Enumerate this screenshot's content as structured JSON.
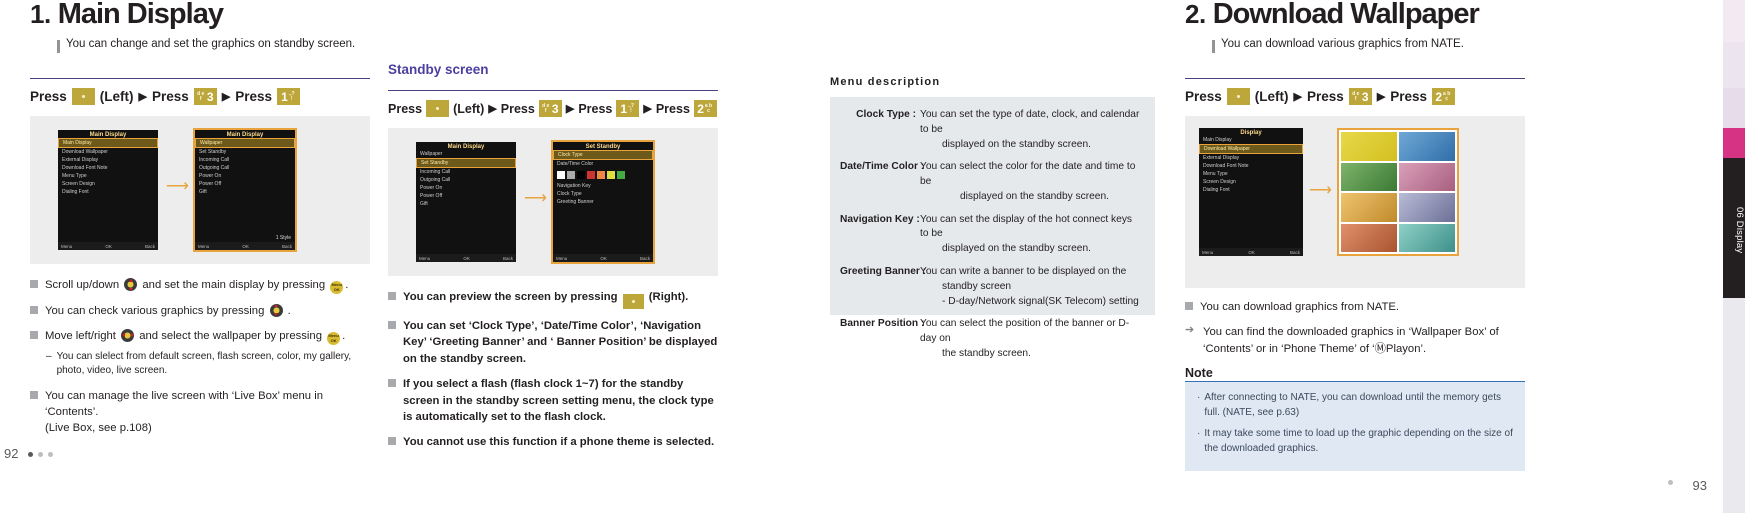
{
  "edge": {
    "tab_label": "06 Display"
  },
  "pages": {
    "left": "92",
    "right": "93"
  },
  "section1": {
    "number": "1.",
    "title": "Main Display",
    "subtitle": "You can change and set the graphics on standby screen.",
    "press_sequence": {
      "press_label": "Press",
      "left_label": "(Left)",
      "arrow": "▶",
      "keys": [
        {
          "type": "dot",
          "label": ""
        },
        {
          "type": "num",
          "big": "3",
          "small": "def"
        },
        {
          "type": "num",
          "big": "1",
          "small": ".,?"
        }
      ]
    },
    "figure": {
      "left_phone": {
        "title": "Main Display",
        "rows": [
          "Main Display",
          "Download Wallpaper",
          "External Display",
          "Download Font Note",
          "Menu Type",
          "Screen Design",
          "Dialing Font"
        ],
        "selected_index": 0,
        "softkeys": [
          "Menu",
          "OK",
          "Back"
        ]
      },
      "right_phone": {
        "title": "Main Display",
        "rows": [
          "Wallpaper",
          "Set Standby",
          "Incoming Call",
          "Outgoing Call",
          "Power On",
          "Power Off",
          "Gift"
        ],
        "selected_index": 0,
        "footer_label": "1 Style",
        "softkeys": [
          "Menu",
          "OK",
          "Back"
        ]
      }
    },
    "bullets": [
      {
        "kind": "square",
        "parts": [
          "Scroll up/down ",
          "{navkey-vert}",
          " and set the main display by pressing ",
          "{okkey}",
          "."
        ]
      },
      {
        "kind": "square",
        "parts": [
          "You can check various graphics by pressing ",
          "{navkey-vert}",
          " ."
        ]
      },
      {
        "kind": "square",
        "parts": [
          "Move left/right ",
          "{navkey-horiz}",
          " and select the wallpaper by pressing ",
          "{okkey}",
          "."
        ]
      },
      {
        "kind": "dash",
        "parts": [
          "You can slelect from default screen, flash screen, color, my gallery, photo, video, live screen."
        ]
      },
      {
        "kind": "square",
        "parts": [
          "You can manage the live screen with ‘Live Box’ menu in ‘Contents’.\n(Live Box, see p.108)"
        ]
      }
    ]
  },
  "section_standby": {
    "title": "Standby screen",
    "press_sequence": {
      "press_label": "Press",
      "left_label": "(Left)",
      "arrow": "▶",
      "keys": [
        {
          "type": "dot",
          "label": ""
        },
        {
          "type": "num",
          "big": "3",
          "small": "def"
        },
        {
          "type": "num",
          "big": "1",
          "small": ".,?"
        },
        {
          "type": "num",
          "big": "2",
          "small": "abc"
        }
      ]
    },
    "figure": {
      "left_phone": {
        "title": "Main Display",
        "rows": [
          "Wallpaper",
          "Set Standby",
          "Incoming Call",
          "Outgoing Call",
          "Power On",
          "Power Off",
          "Gift"
        ],
        "selected_index": 1,
        "softkeys": [
          "Menu",
          "OK",
          "Back"
        ]
      },
      "right_phone": {
        "title": "Set Standby",
        "rows": [
          "Clock Type",
          "Date/Time Color",
          "Navigation Key",
          "Clock Type",
          "Greeting Banner"
        ],
        "selected_index": 0,
        "softkeys": [
          "Menu",
          "OK",
          "Back"
        ]
      }
    },
    "bullets": [
      {
        "kind": "square",
        "parts": [
          "You can preview the screen by pressing ",
          "{dotkey}",
          " (Right)."
        ]
      },
      {
        "kind": "square",
        "parts": [
          "You can set ‘Clock Type’, ‘Date/Time Color’, ‘Navigation Key’ ‘Greeting Banner’ and ‘ Banner Position’ be displayed on the standby screen."
        ]
      },
      {
        "kind": "square",
        "parts": [
          "If you select a flash (flash clock 1~7) for the standby screen in the standby screen setting menu, the clock type is automatically set to the flash clock."
        ]
      },
      {
        "kind": "square",
        "parts": [
          "You cannot use this function if a phone theme is selected."
        ]
      }
    ]
  },
  "menu_description": {
    "heading": "Menu  description",
    "rows": [
      {
        "term": "Clock Type :",
        "lines": [
          "You can set the type of date, clock, and calendar to be",
          "displayed on the standby screen."
        ],
        "indent": [
          0,
          1
        ]
      },
      {
        "term": "Date/Time Color :",
        "lines": [
          "You can select the color for the date and time to be",
          "displayed on the standby screen."
        ],
        "indent": [
          0,
          2
        ]
      },
      {
        "term": "Navigation Key :",
        "lines": [
          "You can set the display of the hot connect keys to be",
          "displayed on the standby screen."
        ],
        "indent": [
          0,
          1
        ]
      },
      {
        "term": "Greeting Banner :",
        "lines": [
          "You can write a banner to be displayed on the",
          "standby screen",
          "- D-day/Network signal(SK Telecom) setting"
        ],
        "indent": [
          0,
          1,
          1
        ]
      },
      {
        "term": "Banner Position :",
        "lines": [
          "You can select the position of the banner or D-day on",
          "the standby screen."
        ],
        "indent": [
          0,
          1
        ]
      }
    ]
  },
  "section2": {
    "number": "2.",
    "title": "Download Wallpaper",
    "subtitle": "You can download various graphics from NATE.",
    "press_sequence": {
      "press_label": "Press",
      "left_label": "(Left)",
      "arrow": "▶",
      "keys": [
        {
          "type": "dot",
          "label": ""
        },
        {
          "type": "num",
          "big": "3",
          "small": "def"
        },
        {
          "type": "num",
          "big": "2",
          "small": "abc"
        }
      ]
    },
    "figure": {
      "left_phone": {
        "title": "Display",
        "rows": [
          "Main Display",
          "Download Wallpaper",
          "External Display",
          "Download Font Note",
          "Menu Type",
          "Screen Design",
          "Dialing Font"
        ],
        "selected_index": 1,
        "softkeys": [
          "Menu",
          "OK",
          "Back"
        ]
      },
      "right_phone": {
        "title": "",
        "rows": [],
        "selected_index": -1,
        "softkeys": []
      }
    },
    "bullets": [
      {
        "kind": "square",
        "parts": [
          "You can download graphics from NATE."
        ]
      },
      {
        "kind": "arrow",
        "parts": [
          "You can find the downloaded graphics in ‘Wallpaper Box’ of ‘Contents’ or in ‘Phone Theme’ of  ‘ⓂPlayon’."
        ]
      }
    ],
    "note": {
      "title": "Note",
      "items": [
        "After connecting to NATE, you can download until the memory gets full. (NATE, see p.63)",
        "It may take some time to load up the graphic depending on the size of the downloaded graphics."
      ]
    }
  },
  "colors": {
    "key_gold": "#bda73a",
    "accent_purple": "#4b3f9f",
    "rule_purple": "#4b3f7f",
    "figure_bg": "#ededed",
    "menu_box_bg": "#e6e9ec",
    "note_bg": "#dfe8f3",
    "note_rule": "#3a6fb5",
    "tab_pink": "#d63384"
  }
}
